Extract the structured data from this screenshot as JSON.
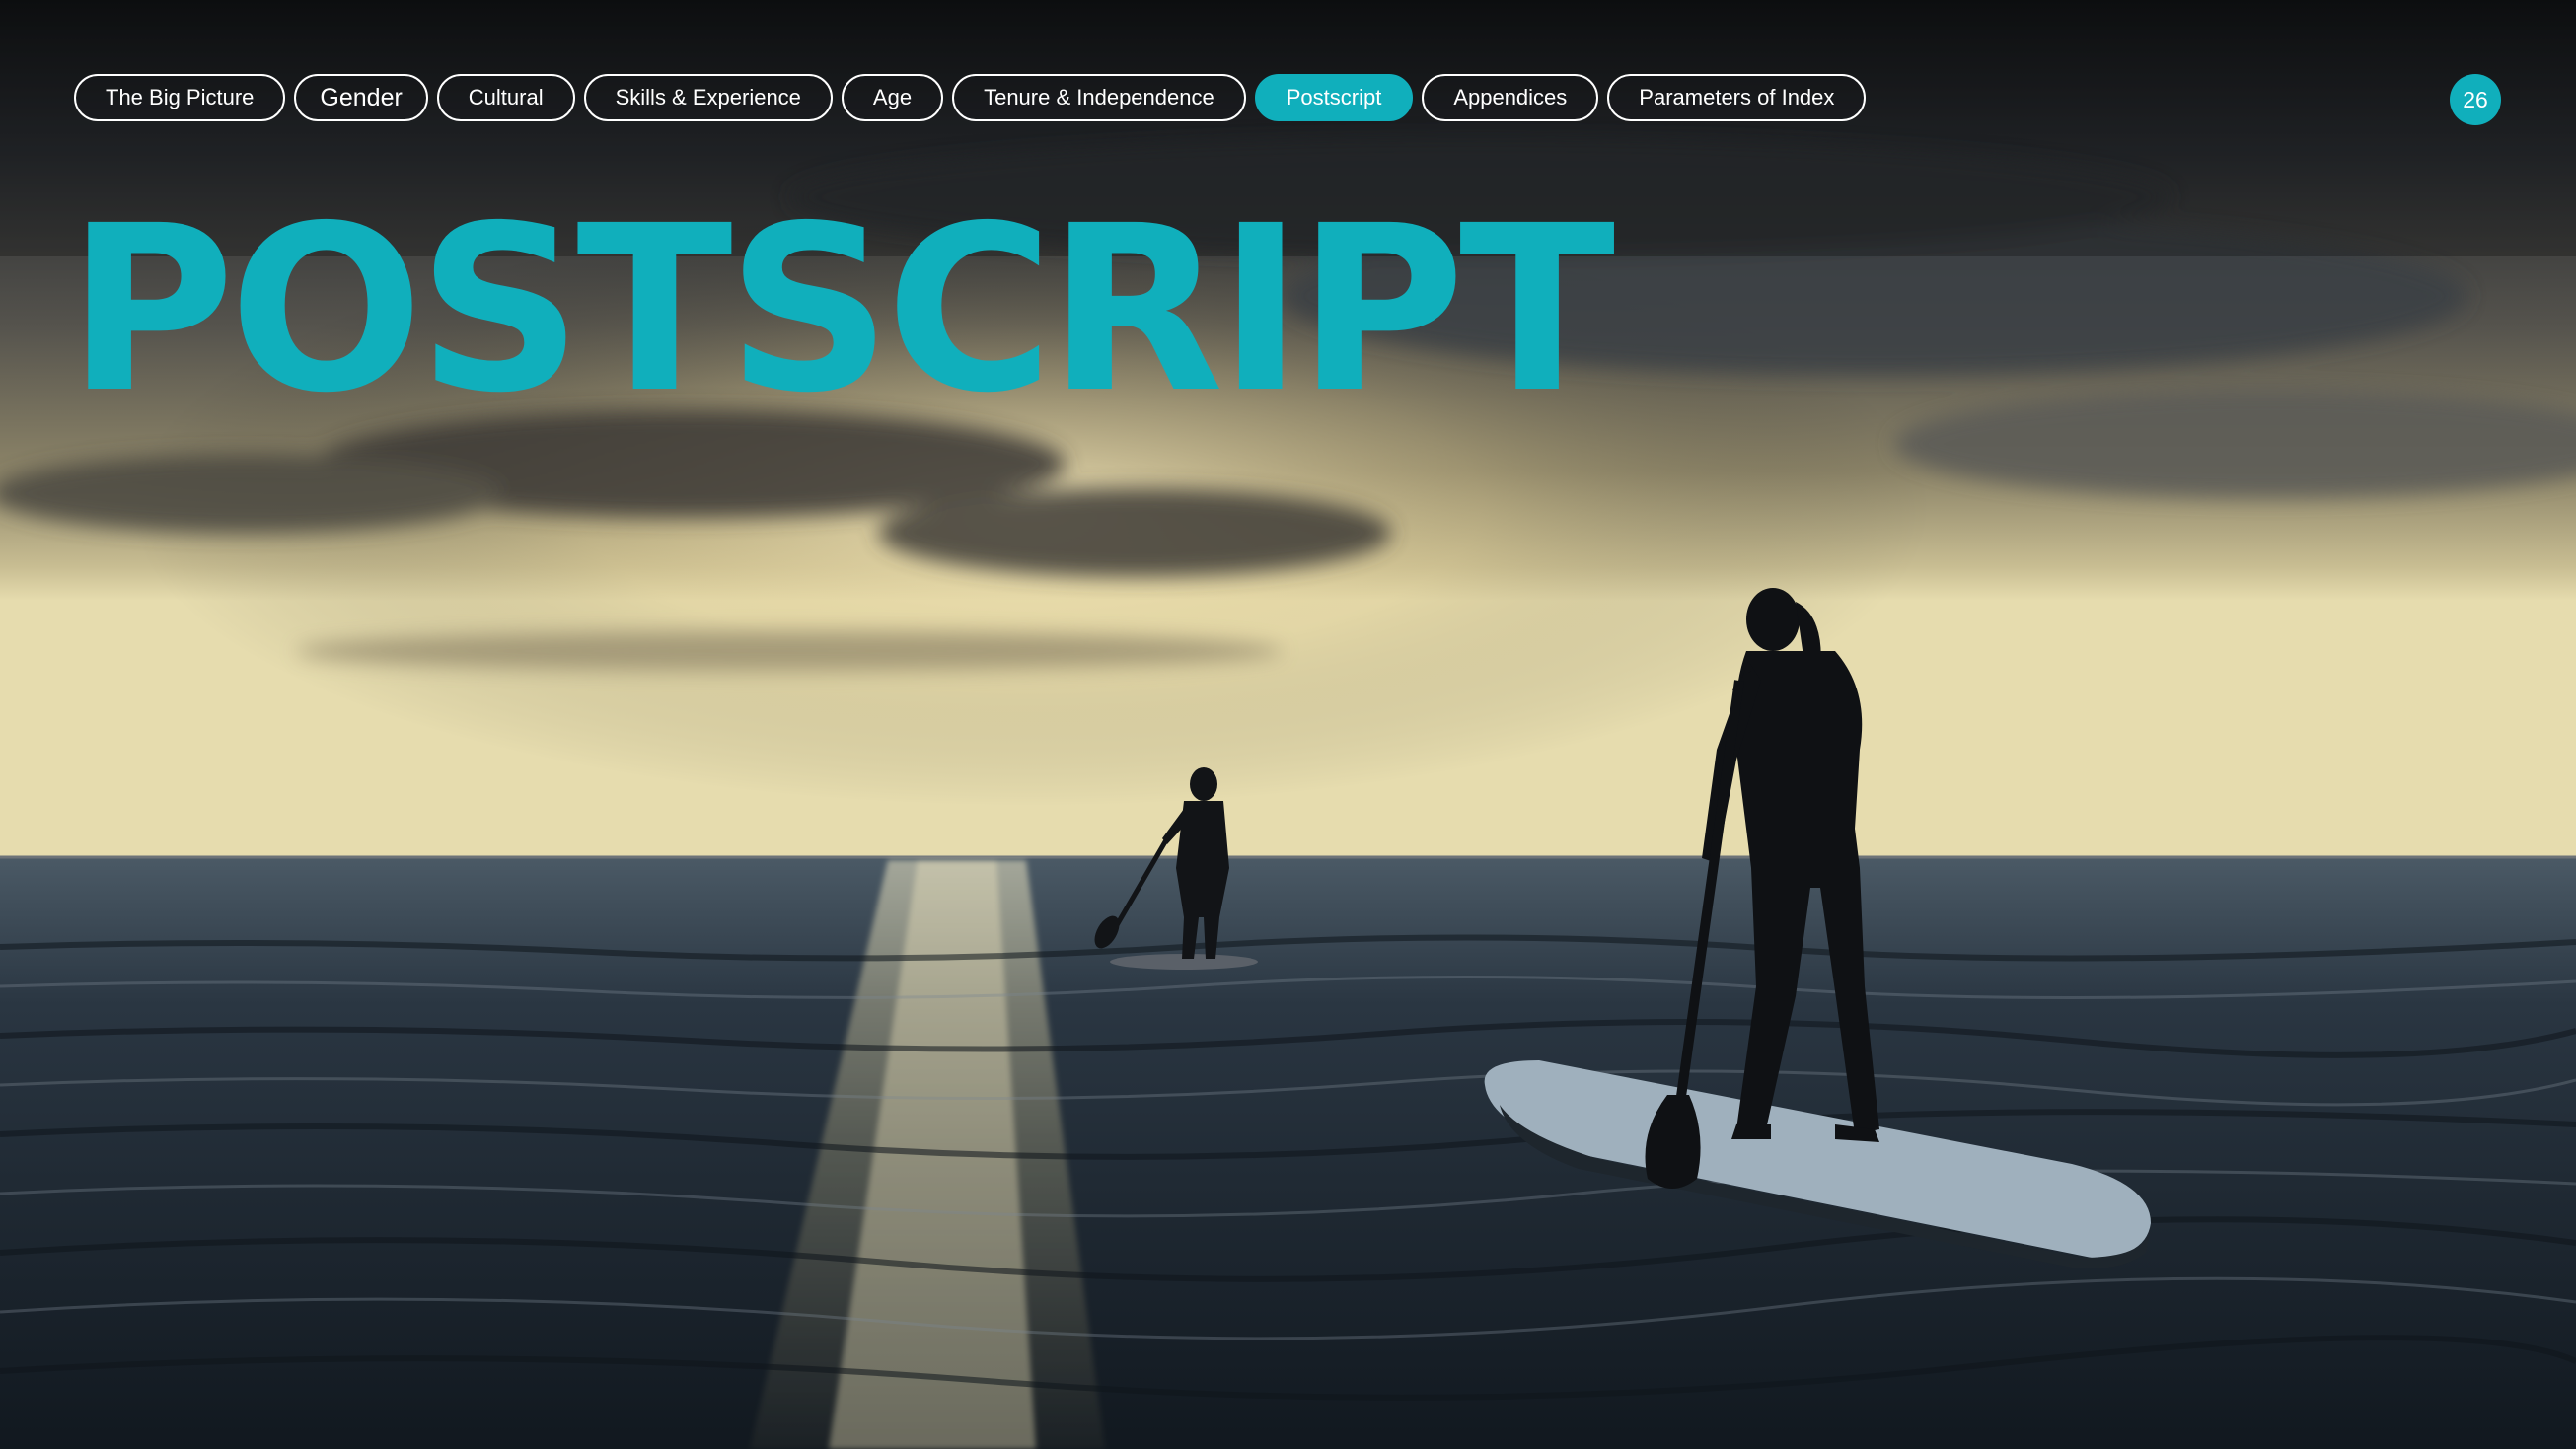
{
  "nav": {
    "items": [
      {
        "label": "The Big Picture",
        "active": false
      },
      {
        "label": "Gender",
        "active": false
      },
      {
        "label": "Cultural",
        "active": false
      },
      {
        "label": "Skills & Experience",
        "active": false
      },
      {
        "label": "Age",
        "active": false
      },
      {
        "label": "Tenure & Independence",
        "active": false
      },
      {
        "label": "Postscript",
        "active": true
      },
      {
        "label": "Appendices",
        "active": false
      },
      {
        "label": "Parameters of Index",
        "active": false
      }
    ]
  },
  "page_number": "26",
  "title": "POSTSCRIPT",
  "colors": {
    "accent": "#10afbc",
    "pill_border": "#ffffff",
    "sky_top": "#16191c",
    "horizon_glow": "#cfc49b",
    "water": "#2a3642"
  },
  "background": {
    "icon": "photo-paddleboarders-sunset"
  }
}
